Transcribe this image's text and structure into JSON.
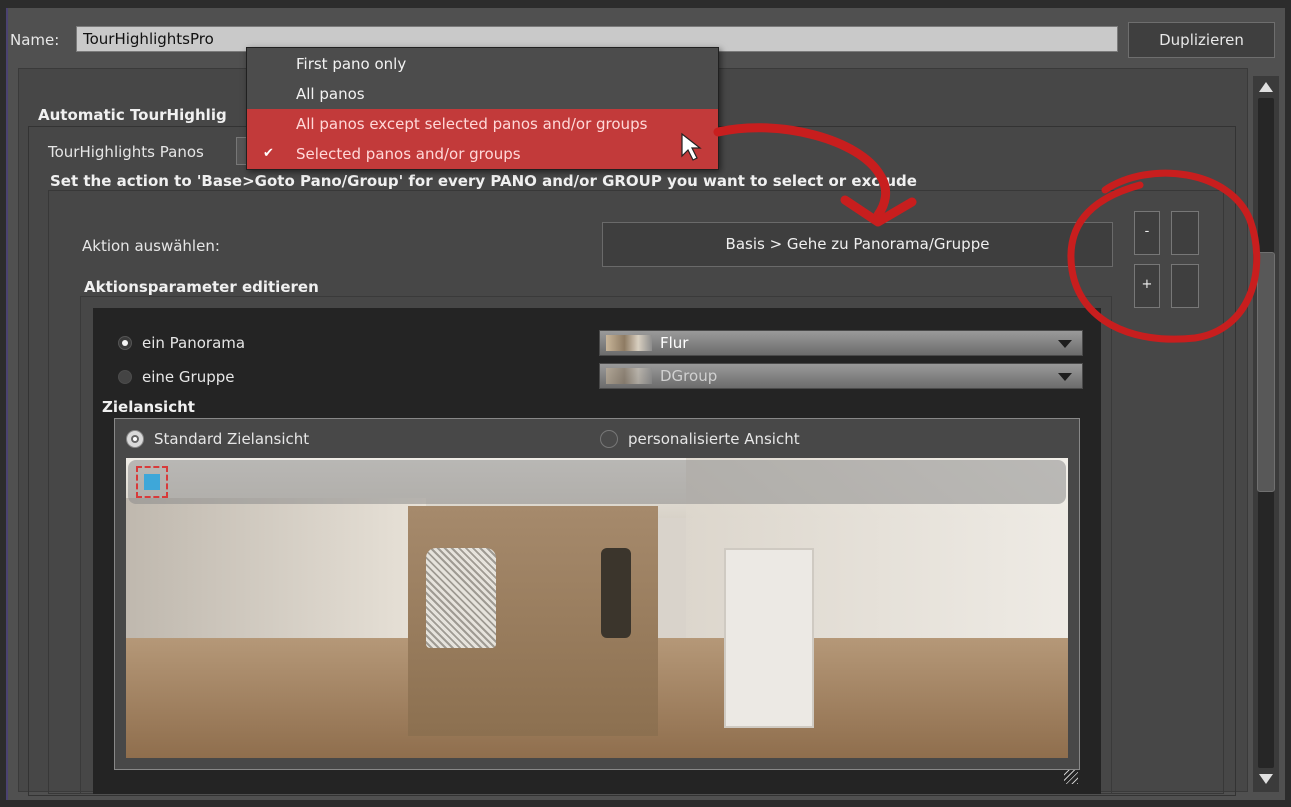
{
  "header": {
    "name_label": "Name:",
    "name_value": "TourHighlightsPro",
    "duplicate_label": "Duplizieren"
  },
  "group": {
    "title": "Automatic TourHighlig",
    "tour_label": "TourHighlights Panos",
    "instruction": "Set the action to 'Base>Goto Pano/Group' for every PANO and/or GROUP you want to select or exclude"
  },
  "popup": {
    "items": [
      {
        "label": "First pano only",
        "checked": false,
        "highlighted": false
      },
      {
        "label": "All panos",
        "checked": false,
        "highlighted": false
      },
      {
        "label": "All panos except selected panos and/or groups",
        "checked": false,
        "highlighted": true
      },
      {
        "label": "Selected panos and/or groups",
        "checked": true,
        "highlighted": true
      }
    ],
    "check_icon": "checkmark-icon"
  },
  "action": {
    "label": "Aktion auswählen:",
    "value": "Basis > Gehe zu Panorama/Gruppe",
    "minus_label": "-",
    "plus_label": "+"
  },
  "params": {
    "title": "Aktionsparameter editieren",
    "radio_pano_label": "ein Panorama",
    "radio_group_label": "eine Gruppe",
    "pano_value": "Flur",
    "group_value": "DGroup",
    "ziel_title": "Zielansicht",
    "standard_view_label": "Standard Zielansicht",
    "custom_view_label": "personalisierte Ansicht"
  },
  "colors": {
    "annotation_red": "#c81e1e",
    "highlight_red": "#c23a3a"
  }
}
